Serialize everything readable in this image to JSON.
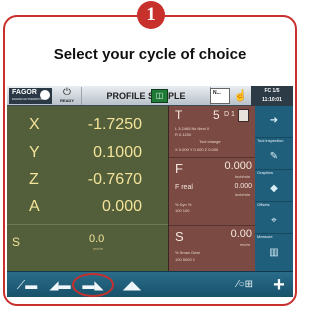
{
  "step": {
    "number": "1",
    "instruction": "Select your cycle of choice"
  },
  "colors": {
    "accent": "#c8302c",
    "axes_panel": "#535f3a",
    "tech_panel": "#7b4a43",
    "side_panel": "#1f5f7c",
    "value_text": "#f4e39a"
  },
  "header": {
    "logo_text": "FAGOR",
    "logo_subtext": "FAGOR AUTOMATION",
    "ready_label": "READY",
    "program_name": "PROFILE SAMPLE",
    "status_icon": "green-status-icon",
    "n_label": "N...",
    "hand_icon": "hand-icon",
    "fc_line1": "FC 1/5",
    "fc_line2": "11:10:01"
  },
  "axes": [
    {
      "name": "X",
      "value": "-1.7250"
    },
    {
      "name": "Y",
      "value": "0.1000"
    },
    {
      "name": "Z",
      "value": "-0.7670"
    },
    {
      "name": "A",
      "value": "0.000"
    }
  ],
  "spindle": {
    "name": "S",
    "value": "0.0",
    "unit": "rev/m"
  },
  "tool": {
    "label": "T",
    "number": "5",
    "d_label": "D 1",
    "details_line1": "L   3.2465   Nx Next   0",
    "details_line2": "R   0.1200",
    "details_line3": "Tool change",
    "details_line4": "X 0.000   Y 0.000   Z 0.000"
  },
  "feed": {
    "label": "F",
    "value": "0.000",
    "unit": "inch/min",
    "real_label": "F real",
    "real_value": "0.000",
    "real_unit": "inch/min",
    "pct_label": "%  Dyn %",
    "pct_values": "100   100"
  },
  "spindle_tech": {
    "label": "S",
    "value": "0.00",
    "unit": "rev/m",
    "sub_labels": "%    Smax    Gear",
    "sub_values": "100   5000    1"
  },
  "side_menu": [
    {
      "label": "",
      "icon": "arrow-icon"
    },
    {
      "label": "Tool inspection",
      "icon": "tool-inspection-icon"
    },
    {
      "label": "Graphics",
      "icon": "graphics-icon"
    },
    {
      "label": "Offsets",
      "icon": "offsets-icon"
    },
    {
      "label": "Measure",
      "icon": "measure-icon"
    }
  ],
  "softkeys": {
    "right_label": "⁄○⊞",
    "plus_label": "+"
  }
}
